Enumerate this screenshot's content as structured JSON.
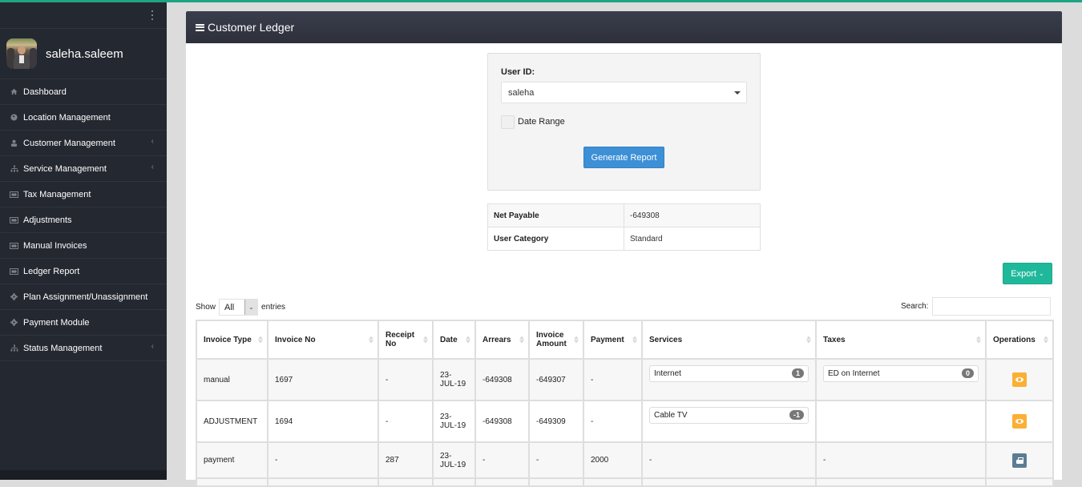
{
  "colors": {
    "accent_bar": "#1fa383",
    "sidebar_bg": "#242830",
    "primary_button": "#3d8fd6",
    "export_button": "#20b89b",
    "view_button": "#fbb034",
    "print_button": "#5a7d94"
  },
  "sidebar": {
    "menu_icon": "kebab-vertical-icon",
    "username": "saleha.saleem",
    "items": [
      {
        "label": "Dashboard",
        "icon": "home-icon",
        "has_submenu": false
      },
      {
        "label": "Location Management",
        "icon": "globe-icon",
        "has_submenu": false
      },
      {
        "label": "Customer Management",
        "icon": "user-icon",
        "has_submenu": true
      },
      {
        "label": "Service Management",
        "icon": "sitemap-icon",
        "has_submenu": true
      },
      {
        "label": "Tax Management",
        "icon": "money-icon",
        "has_submenu": false
      },
      {
        "label": "Adjustments",
        "icon": "money-icon",
        "has_submenu": false
      },
      {
        "label": "Manual Invoices",
        "icon": "money-icon",
        "has_submenu": false
      },
      {
        "label": "Ledger Report",
        "icon": "money-icon",
        "has_submenu": false
      },
      {
        "label": "Plan Assignment/Unassignment",
        "icon": "gear-icon",
        "has_submenu": false
      },
      {
        "label": "Payment Module",
        "icon": "gear-icon",
        "has_submenu": false
      },
      {
        "label": "Status Management",
        "icon": "sitemap-icon",
        "has_submenu": true
      }
    ]
  },
  "panel": {
    "title": "Customer Ledger"
  },
  "form": {
    "user_id_label": "User ID:",
    "user_id_value": "saleha",
    "date_range_label": "Date Range",
    "date_range_checked": false,
    "generate_label": "Generate Report"
  },
  "summary": {
    "rows": [
      {
        "key": "Net Payable",
        "value": "-649308"
      },
      {
        "key": "User Category",
        "value": "Standard"
      }
    ]
  },
  "toolbar": {
    "export_label": "Export",
    "show_label": "Show",
    "entries_value": "All",
    "entries_label": "entries",
    "search_label": "Search:",
    "search_value": ""
  },
  "table": {
    "columns": [
      "Invoice Type",
      "Invoice No",
      "Receipt No",
      "Date",
      "Arrears",
      "Invoice Amount",
      "Payment",
      "Services",
      "Taxes",
      "Operations"
    ],
    "rows": [
      {
        "invoice_type": "manual",
        "invoice_no": "1697",
        "receipt_no": "-",
        "date": "23-JUL-19",
        "arrears": "-649308",
        "invoice_amount": "-649307",
        "payment": "-",
        "service": {
          "name": "Internet",
          "count": "1"
        },
        "tax": {
          "name": "ED on Internet",
          "count": "0"
        },
        "operation": "view"
      },
      {
        "invoice_type": "ADJUSTMENT",
        "invoice_no": "1694",
        "receipt_no": "-",
        "date": "23-JUL-19",
        "arrears": "-649308",
        "invoice_amount": "-649309",
        "payment": "-",
        "service": {
          "name": "Cable TV",
          "count": "-1"
        },
        "tax": null,
        "operation": "view"
      },
      {
        "invoice_type": "payment",
        "invoice_no": "-",
        "receipt_no": "287",
        "date": "23-JUL-19",
        "arrears": "-",
        "invoice_amount": "-",
        "payment": "2000",
        "services_text": "-",
        "taxes_text": "-",
        "operation": "print"
      }
    ]
  }
}
